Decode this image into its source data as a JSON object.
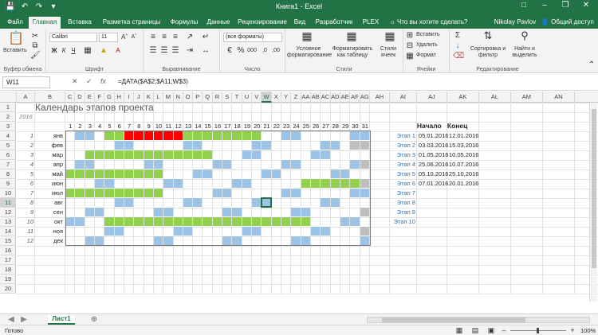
{
  "window": {
    "title": "Книга1 - Excel",
    "user": "Nikolay Pavlov",
    "share_label": "Общий доступ",
    "tell_me": "Что вы хотите сделать?"
  },
  "tabs": [
    "Файл",
    "Главная",
    "Вставка",
    "Разметка страницы",
    "Формулы",
    "Данные",
    "Рецензирование",
    "Вид",
    "Разработчик",
    "PLEX"
  ],
  "ribbon": {
    "paste_label": "Вставить",
    "clipboard_label": "Буфер обмена",
    "font_name": "Calibri",
    "font_size": "11",
    "font_label": "Шрифт",
    "align_label": "Выравнивание",
    "number_format": "(все форматы)",
    "number_label": "Число",
    "cond_format": "Условное форматирование",
    "format_table": "Форматировать как таблицу",
    "cell_styles": "Стили ячеек",
    "styles_label": "Стили",
    "insert_label": "Вставить",
    "delete_label": "Удалить",
    "format_label": "Формат",
    "cells_label": "Ячейки",
    "sort_label": "Сортировка и фильтр",
    "find_label": "Найти и выделить",
    "editing_label": "Редактирование"
  },
  "formula_bar": {
    "name_box": "W11",
    "formula": "=ДАТА($A$2;$A11;W$3)"
  },
  "columns": [
    "A",
    "B",
    "C",
    "D",
    "E",
    "F",
    "G",
    "H",
    "I",
    "J",
    "K",
    "L",
    "M",
    "N",
    "O",
    "P",
    "Q",
    "R",
    "S",
    "T",
    "U",
    "V",
    "W",
    "X",
    "Y",
    "Z",
    "AA",
    "AB",
    "AC",
    "AD",
    "AE",
    "AF",
    "AG",
    "AH",
    "AI",
    "AJ",
    "AK",
    "AL",
    "AM",
    "AN"
  ],
  "rows": [
    "1",
    "2",
    "3",
    "4",
    "5",
    "6",
    "7",
    "8",
    "9",
    "10",
    "11",
    "12",
    "13",
    "14",
    "15",
    "16",
    "17",
    "18",
    "19",
    "20"
  ],
  "sheet": {
    "title": "Календарь этапов проекта",
    "year": "2016",
    "days": [
      "1",
      "2",
      "3",
      "4",
      "5",
      "6",
      "7",
      "8",
      "9",
      "10",
      "11",
      "12",
      "13",
      "14",
      "15",
      "16",
      "17",
      "18",
      "19",
      "20",
      "21",
      "22",
      "23",
      "24",
      "25",
      "26",
      "27",
      "28",
      "29",
      "30",
      "31"
    ],
    "month_nums": [
      "1",
      "2",
      "3",
      "4",
      "5",
      "6",
      "7",
      "8",
      "9",
      "10",
      "11",
      "12"
    ],
    "months": [
      "янв",
      "фев",
      "мар",
      "апр",
      "май",
      "июн",
      "июл",
      "авг",
      "сен",
      "окт",
      "ноя",
      "дек"
    ],
    "header_start": "Начало",
    "header_end": "Конец",
    "stages": [
      {
        "name": "Этап 1",
        "start": "05.01.2016",
        "end": "12.01.2016"
      },
      {
        "name": "Этап 2",
        "start": "03.03.2016",
        "end": "15.03.2016"
      },
      {
        "name": "Этап 3",
        "start": "01.05.2016",
        "end": "10.05.2016"
      },
      {
        "name": "Этап 4",
        "start": "25.06.2016",
        "end": "10.07.2016"
      },
      {
        "name": "Этап 5",
        "start": "05.10.2016",
        "end": "25.10.2016"
      },
      {
        "name": "Этап 6",
        "start": "07.01.2016",
        "end": "20.01.2016"
      },
      {
        "name": "Этап 7",
        "start": "",
        "end": ""
      },
      {
        "name": "Этап 8",
        "start": "",
        "end": ""
      },
      {
        "name": "Этап 9",
        "start": "",
        "end": ""
      },
      {
        "name": "Этап 10",
        "start": "",
        "end": ""
      }
    ],
    "weekends": [
      [
        2,
        3,
        9,
        10,
        16,
        17,
        23,
        24,
        30,
        31
      ],
      [
        6,
        7,
        13,
        14,
        20,
        21,
        27,
        28
      ],
      [
        5,
        6,
        12,
        13,
        19,
        20,
        26,
        27
      ],
      [
        2,
        3,
        9,
        10,
        16,
        17,
        23,
        24,
        30
      ],
      [
        1,
        7,
        8,
        14,
        15,
        21,
        22,
        28,
        29
      ],
      [
        4,
        5,
        11,
        12,
        18,
        19,
        25,
        26
      ],
      [
        2,
        3,
        9,
        10,
        16,
        17,
        23,
        24,
        30,
        31
      ],
      [
        6,
        7,
        13,
        14,
        20,
        21,
        27,
        28
      ],
      [
        3,
        4,
        10,
        11,
        17,
        18,
        24,
        25
      ],
      [
        1,
        2,
        8,
        9,
        15,
        16,
        22,
        23,
        29,
        30
      ],
      [
        5,
        6,
        12,
        13,
        19,
        20,
        26,
        27
      ],
      [
        3,
        4,
        10,
        11,
        17,
        18,
        24,
        25,
        31
      ]
    ],
    "invalid_days": [
      [],
      [
        30,
        31
      ],
      [],
      [
        31
      ],
      [],
      [
        31
      ],
      [],
      [],
      [
        31
      ],
      [],
      [
        31
      ],
      []
    ],
    "bars": [
      {
        "month": 1,
        "from": 5,
        "to": 12,
        "color": "#92d050"
      },
      {
        "month": 1,
        "from": 7,
        "to": 20,
        "color": "#92d050"
      },
      {
        "month": 3,
        "from": 3,
        "to": 15,
        "color": "#92d050"
      },
      {
        "month": 5,
        "from": 1,
        "to": 10,
        "color": "#92d050"
      },
      {
        "month": 6,
        "from": 25,
        "to": 30,
        "color": "#92d050"
      },
      {
        "month": 7,
        "from": 1,
        "to": 10,
        "color": "#92d050"
      },
      {
        "month": 10,
        "from": 5,
        "to": 25,
        "color": "#92d050"
      }
    ],
    "overlaps": [
      {
        "month": 1,
        "from": 7,
        "to": 12,
        "color": "#ff0000"
      }
    ],
    "colors": {
      "weekend": "#9dc3e6",
      "invalid": "#bfbfbf",
      "stage_text": "#2e75b6"
    }
  },
  "sheet_tab": "Лист1",
  "status": {
    "ready": "Готово",
    "zoom": "100%"
  }
}
